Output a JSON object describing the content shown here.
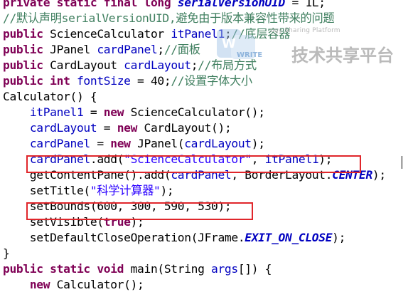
{
  "code_lines": [
    {
      "segments": [
        {
          "t": "private static final long ",
          "c": "kw"
        },
        {
          "t": "serialVersionUID",
          "c": "sfield"
        },
        {
          "t": " = 1L;",
          "c": ""
        }
      ]
    },
    {
      "segments": [
        {
          "t": "//默认声明serialVersionUID,避免由于版本兼容性带来的问题",
          "c": "cmt"
        }
      ]
    },
    {
      "segments": [
        {
          "t": "public ",
          "c": "kw"
        },
        {
          "t": "ScienceCalculator ",
          "c": ""
        },
        {
          "t": "itPanel1",
          "c": "field"
        },
        {
          "t": ";",
          "c": ""
        },
        {
          "t": "//底层容器",
          "c": "cmt"
        }
      ]
    },
    {
      "segments": [
        {
          "t": "public ",
          "c": "kw"
        },
        {
          "t": "JPanel ",
          "c": ""
        },
        {
          "t": "cardPanel",
          "c": "field"
        },
        {
          "t": ";",
          "c": ""
        },
        {
          "t": "//面板",
          "c": "cmt"
        }
      ]
    },
    {
      "segments": [
        {
          "t": "public ",
          "c": "kw"
        },
        {
          "t": "CardLayout ",
          "c": ""
        },
        {
          "t": "cardLayout",
          "c": "field"
        },
        {
          "t": ";",
          "c": ""
        },
        {
          "t": "//布局方式",
          "c": "cmt"
        }
      ]
    },
    {
      "segments": [
        {
          "t": "public int ",
          "c": "kw"
        },
        {
          "t": "fontSize",
          "c": "field"
        },
        {
          "t": " = 40;",
          "c": ""
        },
        {
          "t": "//设置字体大小",
          "c": "cmt"
        }
      ]
    },
    {
      "segments": [
        {
          "t": "Calculator() {",
          "c": ""
        }
      ]
    },
    {
      "segments": [
        {
          "t": "    ",
          "c": ""
        },
        {
          "t": "itPanel1",
          "c": "field"
        },
        {
          "t": " = ",
          "c": ""
        },
        {
          "t": "new ",
          "c": "kw"
        },
        {
          "t": "ScienceCalculator();",
          "c": ""
        }
      ]
    },
    {
      "segments": [
        {
          "t": "    ",
          "c": ""
        },
        {
          "t": "cardLayout",
          "c": "field"
        },
        {
          "t": " = ",
          "c": ""
        },
        {
          "t": "new ",
          "c": "kw"
        },
        {
          "t": "CardLayout();",
          "c": ""
        }
      ]
    },
    {
      "segments": [
        {
          "t": "    ",
          "c": ""
        },
        {
          "t": "cardPanel",
          "c": "field"
        },
        {
          "t": " = ",
          "c": ""
        },
        {
          "t": "new ",
          "c": "kw"
        },
        {
          "t": "JPanel(",
          "c": ""
        },
        {
          "t": "cardLayout",
          "c": "field"
        },
        {
          "t": ");",
          "c": ""
        }
      ]
    },
    {
      "segments": [
        {
          "t": "    ",
          "c": ""
        },
        {
          "t": "cardPanel",
          "c": "field"
        },
        {
          "t": ".add(",
          "c": ""
        },
        {
          "t": "\"ScienceCalculator\"",
          "c": "str"
        },
        {
          "t": ", ",
          "c": ""
        },
        {
          "t": "itPanel1",
          "c": "field"
        },
        {
          "t": ");",
          "c": ""
        }
      ]
    },
    {
      "segments": [
        {
          "t": "    getContentPane().add(",
          "c": ""
        },
        {
          "t": "cardPanel",
          "c": "field"
        },
        {
          "t": ", BorderLayout.",
          "c": ""
        },
        {
          "t": "CENTER",
          "c": "sfield"
        },
        {
          "t": ");",
          "c": ""
        }
      ]
    },
    {
      "segments": [
        {
          "t": "    setTitle(",
          "c": ""
        },
        {
          "t": "\"科学计算器\"",
          "c": "str"
        },
        {
          "t": ");",
          "c": ""
        }
      ]
    },
    {
      "segments": [
        {
          "t": "    setBounds(600, 300, 590, 530);",
          "c": ""
        }
      ]
    },
    {
      "segments": [
        {
          "t": "    setVisible(",
          "c": ""
        },
        {
          "t": "true",
          "c": "kw"
        },
        {
          "t": ");",
          "c": ""
        }
      ]
    },
    {
      "segments": [
        {
          "t": "    setDefaultCloseOperation(JFrame.",
          "c": ""
        },
        {
          "t": "EXIT_ON_CLOSE",
          "c": "sfield"
        },
        {
          "t": ");",
          "c": ""
        }
      ]
    },
    {
      "segments": [
        {
          "t": "}",
          "c": ""
        }
      ]
    },
    {
      "segments": [
        {
          "t": "public static void ",
          "c": "kw"
        },
        {
          "t": "main(String ",
          "c": ""
        },
        {
          "t": "args",
          "c": "field"
        },
        {
          "t": "[]) {",
          "c": ""
        }
      ]
    },
    {
      "segments": [
        {
          "t": "    ",
          "c": ""
        },
        {
          "t": "new ",
          "c": "kw"
        },
        {
          "t": "Calculator();",
          "c": ""
        }
      ]
    }
  ],
  "watermark": {
    "tagline": "ogy Sharing Platform",
    "title": "技术共享平台",
    "logo_text": "WRITE"
  }
}
